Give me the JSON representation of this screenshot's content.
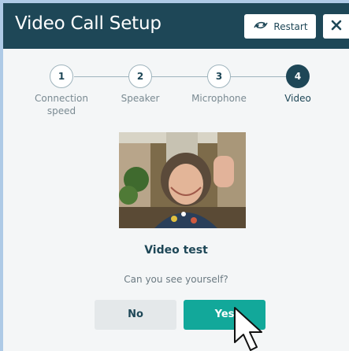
{
  "dialog": {
    "title": "Video Call Setup",
    "restart_label": "Restart",
    "close_icon": "close-icon",
    "restart_icon": "refresh-arrows-icon"
  },
  "steps": [
    {
      "number": "1",
      "label": "Connection speed",
      "active": false
    },
    {
      "number": "2",
      "label": "Speaker",
      "active": false
    },
    {
      "number": "3",
      "label": "Microphone",
      "active": false
    },
    {
      "number": "4",
      "label": "Video",
      "active": true
    }
  ],
  "video_test": {
    "title": "Video test",
    "question": "Can you see yourself?",
    "no_label": "No",
    "yes_label": "Yes"
  },
  "colors": {
    "header": "#1e4757",
    "accent": "#12a89a",
    "background": "#aecae6"
  }
}
